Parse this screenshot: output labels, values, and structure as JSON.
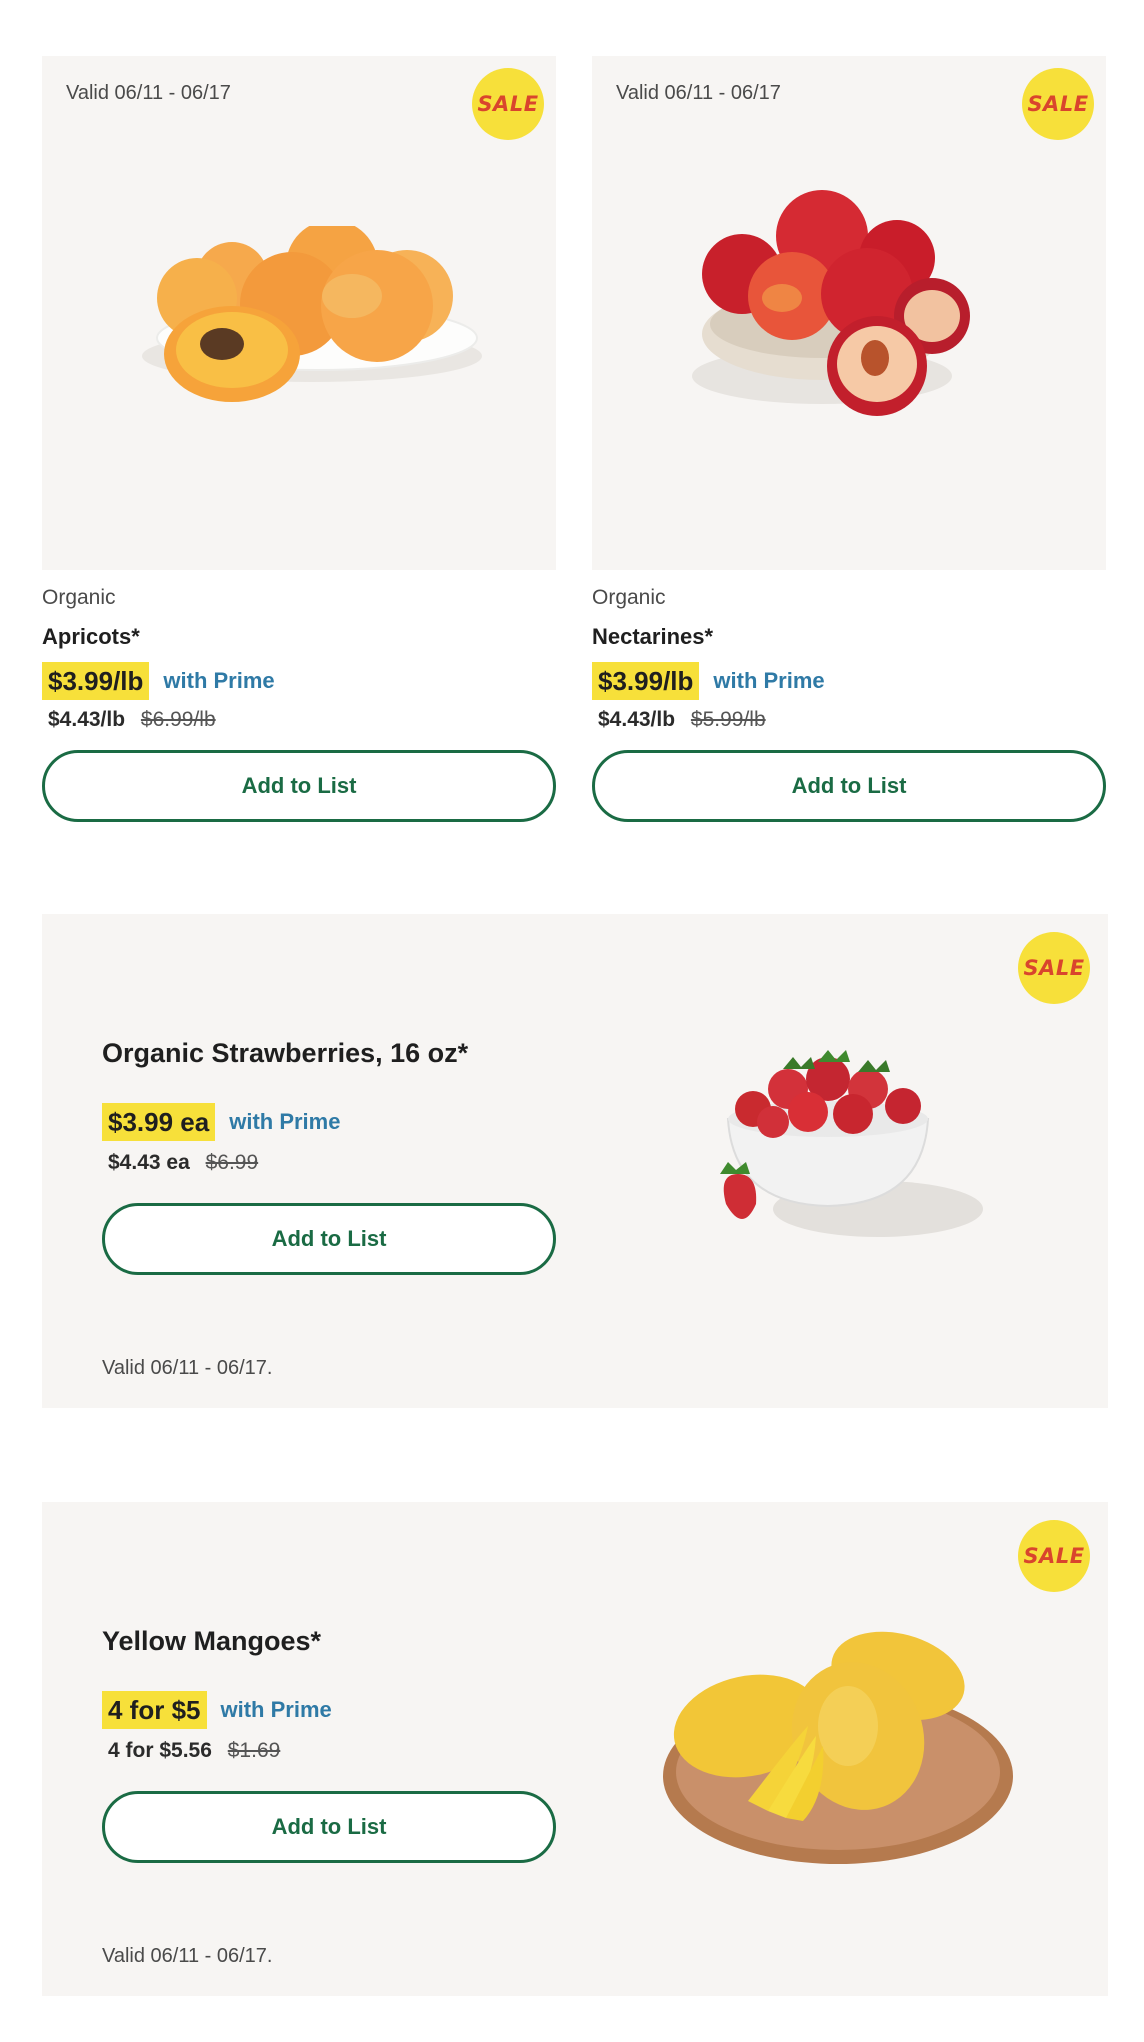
{
  "products": [
    {
      "valid": "Valid 06/11 - 06/17",
      "sale": "SALE",
      "brand": "Organic",
      "name": "Apricots*",
      "prime_price": "$3.99/lb",
      "with_prime": "with Prime",
      "regular_price": "$4.43/lb",
      "old_price": "$6.99/lb",
      "button": "Add to List"
    },
    {
      "valid": "Valid 06/11 - 06/17",
      "sale": "SALE",
      "brand": "Organic",
      "name": "Nectarines*",
      "prime_price": "$3.99/lb",
      "with_prime": "with Prime",
      "regular_price": "$4.43/lb",
      "old_price": "$5.99/lb",
      "button": "Add to List"
    }
  ],
  "featured": [
    {
      "sale": "SALE",
      "name": "Organic Strawberries, 16 oz*",
      "prime_price": "$3.99 ea",
      "with_prime": "with Prime",
      "regular_price": "$4.43 ea",
      "old_price": "$6.99",
      "button": "Add to List",
      "valid": "Valid 06/11 - 06/17."
    },
    {
      "sale": "SALE",
      "name": "Yellow Mangoes*",
      "prime_price": "4 for $5",
      "with_prime": "with Prime",
      "regular_price": "4 for $5.56",
      "old_price": "$1.69",
      "button": "Add to List",
      "valid": "Valid 06/11 - 06/17."
    }
  ],
  "colors": {
    "sale_badge": "#f7e03a",
    "sale_text": "#d9452d",
    "price_highlight": "#f7e03a",
    "prime_blue": "#2f7aa6",
    "button_green": "#1a6b44",
    "card_bg": "#f7f5f3"
  }
}
